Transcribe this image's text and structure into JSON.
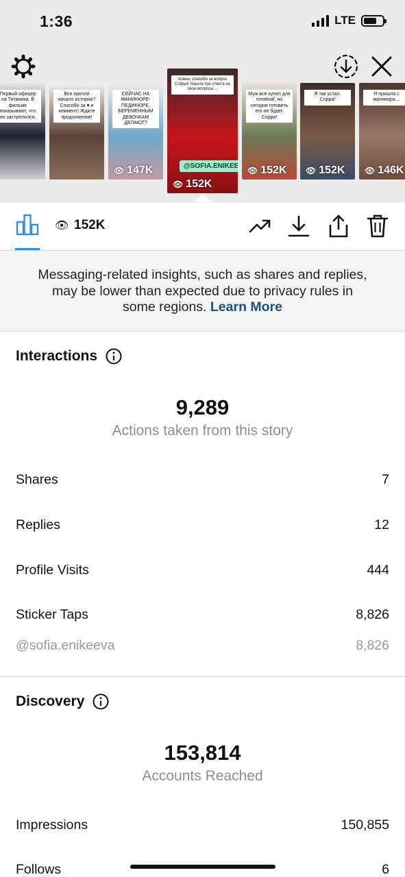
{
  "status_bar": {
    "time": "1:36",
    "network": "LTE",
    "battery_level": 0.7
  },
  "header_icons": {
    "settings": "gear-icon",
    "download": "download-circle-icon",
    "close": "close-icon"
  },
  "stories": [
    {
      "views": "",
      "caption": "Первый офицер на Титаника. В фильме показывают, что он застрелился.",
      "colors": [
        "#e9e7e2",
        "#1c2230",
        "#d0d2d6"
      ]
    },
    {
      "views": "",
      "caption": "Все прочли начало истории? Спасибо за ♥ и коммент! Ждите продолжение!",
      "colors": [
        "#f3f1ee",
        "#5b4434",
        "#8a6e5e"
      ]
    },
    {
      "views": "147K",
      "caption": "СЕЙЧАС НА МАНИКЮРЕ-ПЕДИКЮРЕ. БЕРЕМЕННЫМ ДЕВОЧКАМ ДЕЛАЮТ?",
      "colors": [
        "#ececec",
        "#6fa8c9",
        "#c49aa0"
      ]
    },
    {
      "views": "152K",
      "caption": "Алена, спасибо за вопрос Софья! Нашла три ответа на свои вопросы…",
      "mention": "@SOFIA.ENIKEEVA",
      "colors": [
        "#3a2a2a",
        "#c4161c",
        "#8b0f14"
      ],
      "selected": true
    },
    {
      "views": "152K",
      "caption": "Муж всё купил для meatloaf, но сегодня готовить его не будет. Сорри!",
      "colors": [
        "#e9e4dc",
        "#6a7a55",
        "#b84a3a"
      ]
    },
    {
      "views": "152K",
      "caption": "Я так устал. Сорри!",
      "colors": [
        "#3a2e2a",
        "#7b5a45",
        "#3b4d66"
      ]
    },
    {
      "views": "146K",
      "caption": "Я пришла с маникюра…",
      "colors": [
        "#4a3530",
        "#9a7766",
        "#6f4e40"
      ]
    }
  ],
  "toolbar": {
    "views": "152K",
    "icons": [
      "bar-chart-icon",
      "eye-icon",
      "trending-icon",
      "download-icon",
      "share-icon",
      "trash-icon"
    ],
    "accent": "#2d8fea"
  },
  "notice": {
    "text": "Messaging-related insights, such as shares and replies, may be lower than expected due to privacy rules in some regions. ",
    "link": "Learn More"
  },
  "interactions": {
    "title": "Interactions",
    "total": "9,289",
    "subtitle": "Actions taken from this story",
    "rows": [
      {
        "label": "Shares",
        "value": "7"
      },
      {
        "label": "Replies",
        "value": "12"
      },
      {
        "label": "Profile Visits",
        "value": "444"
      },
      {
        "label": "Sticker Taps",
        "value": "8,826"
      }
    ],
    "sub_row": {
      "label": "@sofia.enikeeva",
      "value": "8,826"
    }
  },
  "discovery": {
    "title": "Discovery",
    "total": "153,814",
    "subtitle": "Accounts Reached",
    "rows": [
      {
        "label": "Impressions",
        "value": "150,855"
      },
      {
        "label": "Follows",
        "value": "6"
      }
    ]
  }
}
